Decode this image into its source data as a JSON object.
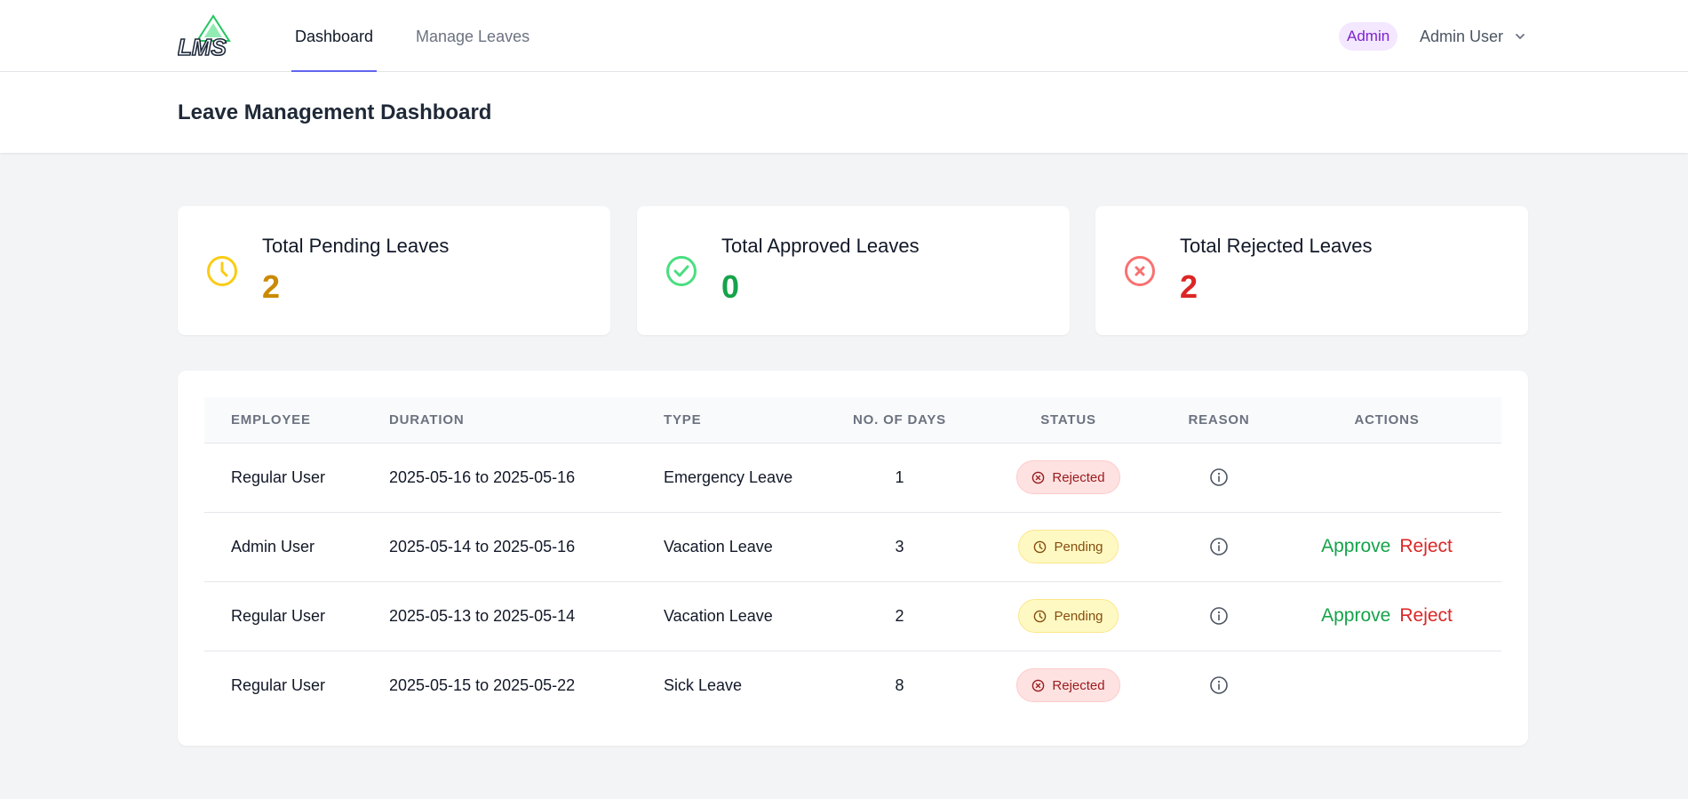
{
  "app": {
    "logo_text": "LMS"
  },
  "nav": {
    "links": [
      {
        "label": "Dashboard",
        "active": true
      },
      {
        "label": "Manage Leaves",
        "active": false
      }
    ]
  },
  "user": {
    "role": "Admin",
    "name": "Admin User"
  },
  "page": {
    "title": "Leave Management Dashboard"
  },
  "stats": [
    {
      "label": "Total Pending Leaves",
      "value": "2",
      "icon": "clock-icon",
      "color": "#ca8a04",
      "icon_color": "#facc15"
    },
    {
      "label": "Total Approved Leaves",
      "value": "0",
      "icon": "check-circle-icon",
      "color": "#16a34a",
      "icon_color": "#4ade80"
    },
    {
      "label": "Total Rejected Leaves",
      "value": "2",
      "icon": "x-circle-icon",
      "color": "#dc2626",
      "icon_color": "#f87171"
    }
  ],
  "table": {
    "headers": [
      "EMPLOYEE",
      "DURATION",
      "TYPE",
      "NO. OF DAYS",
      "STATUS",
      "REASON",
      "ACTIONS"
    ],
    "rows": [
      {
        "employee": "Regular User",
        "duration": "2025-05-16 to 2025-05-16",
        "type": "Emergency Leave",
        "days": "1",
        "status": "Rejected",
        "approve": "",
        "reject": ""
      },
      {
        "employee": "Admin User",
        "duration": "2025-05-14 to 2025-05-16",
        "type": "Vacation Leave",
        "days": "3",
        "status": "Pending",
        "approve": "Approve",
        "reject": "Reject"
      },
      {
        "employee": "Regular User",
        "duration": "2025-05-13 to 2025-05-14",
        "type": "Vacation Leave",
        "days": "2",
        "status": "Pending",
        "approve": "Approve",
        "reject": "Reject"
      },
      {
        "employee": "Regular User",
        "duration": "2025-05-15 to 2025-05-22",
        "type": "Sick Leave",
        "days": "8",
        "status": "Rejected",
        "approve": "",
        "reject": ""
      }
    ]
  }
}
